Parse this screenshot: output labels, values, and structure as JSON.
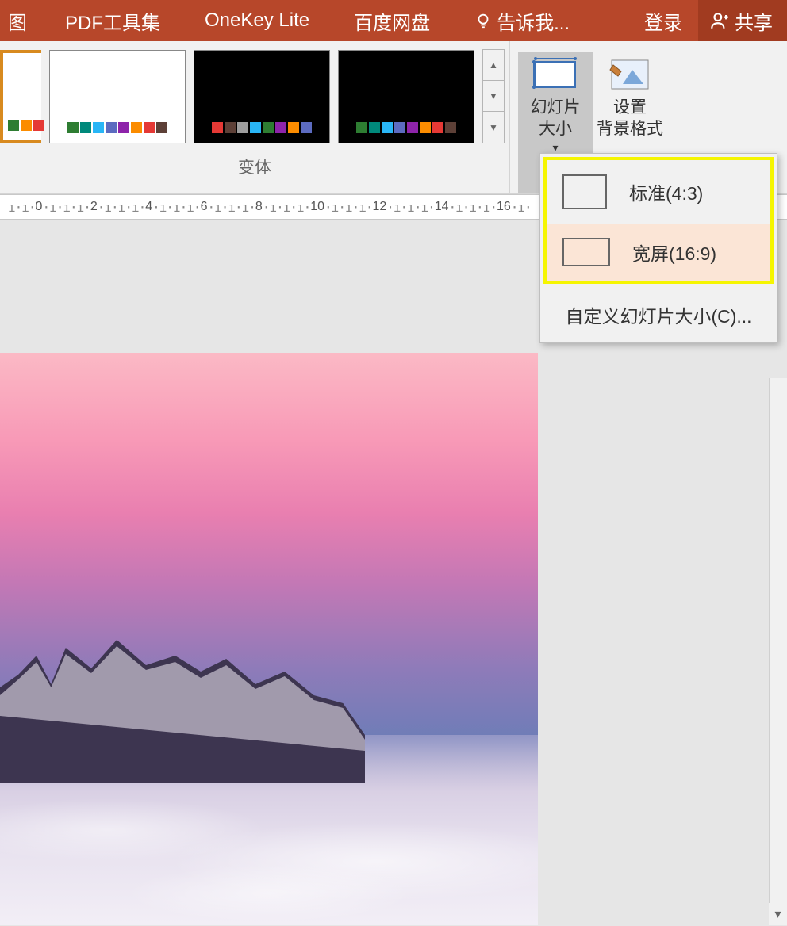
{
  "tabs": {
    "view": "图",
    "pdf": "PDF工具集",
    "onekey": "OneKey Lite",
    "baidu": "百度网盘",
    "tellme": "告诉我...",
    "login": "登录",
    "share": "共享"
  },
  "variant_colors_light": [
    "#2e7d32",
    "#00897b",
    "#29b6f6",
    "#5c6bc0",
    "#8e24aa",
    "#fb8c00",
    "#e53935",
    "#5d4037"
  ],
  "variant_colors_d1": [
    "#e53935",
    "#5d4037",
    "#757575",
    "#29b6f6",
    "#2e7d32",
    "#8e24aa",
    "#fb8c00",
    "#5c6bc0"
  ],
  "variant_colors_d2": [
    "#2e7d32",
    "#00897b",
    "#29b6f6",
    "#5c6bc0",
    "#8e24aa",
    "#fb8c00",
    "#e53935",
    "#5d4037"
  ],
  "section_variants": "变体",
  "btn_slide_size": "幻灯片\n大小",
  "btn_bg_format": "设置\n背景格式",
  "ruler_marks": [
    0,
    2,
    4,
    6,
    8,
    10,
    12,
    14,
    16
  ],
  "menu": {
    "standard": "标准(4:3)",
    "wide": "宽屏(16:9)",
    "custom": "自定义幻灯片大小(C)..."
  }
}
